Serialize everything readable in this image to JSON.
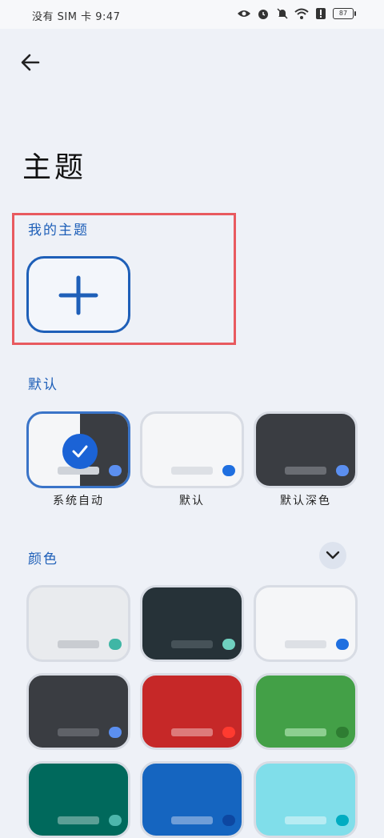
{
  "status": {
    "left_text": "没有 SIM 卡 9:47",
    "battery": "87"
  },
  "page": {
    "title": "主题"
  },
  "sections": {
    "mine": "我的主题",
    "default": "默认",
    "colors": "颜色"
  },
  "default_themes": [
    {
      "label": "系统自动",
      "selected": true
    },
    {
      "label": "默认",
      "selected": false
    },
    {
      "label": "默认深色",
      "selected": false
    }
  ],
  "colors": {
    "accent": "#1e5fb8",
    "highlight_border": "#e85a5f",
    "selected_check": "#1b63d6"
  }
}
